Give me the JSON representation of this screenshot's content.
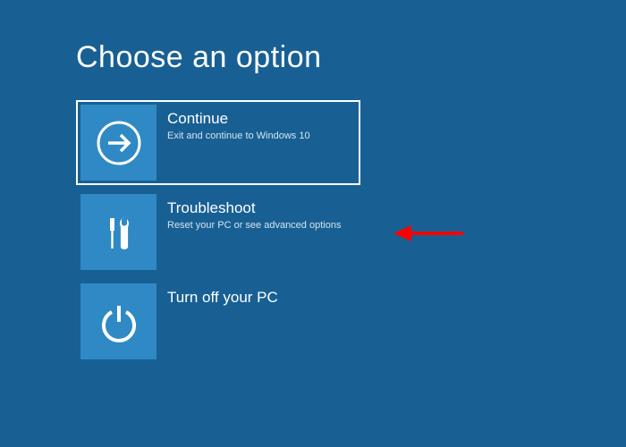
{
  "title": "Choose an option",
  "options": [
    {
      "icon": "arrow-right",
      "title": "Continue",
      "desc": "Exit and continue to Windows 10",
      "focused": true
    },
    {
      "icon": "tools",
      "title": "Troubleshoot",
      "desc": "Reset your PC or see advanced options",
      "focused": false
    },
    {
      "icon": "power",
      "title": "Turn off your PC",
      "desc": "",
      "focused": false
    }
  ],
  "annotation": {
    "type": "red-arrow",
    "points_to": "troubleshoot-option"
  }
}
